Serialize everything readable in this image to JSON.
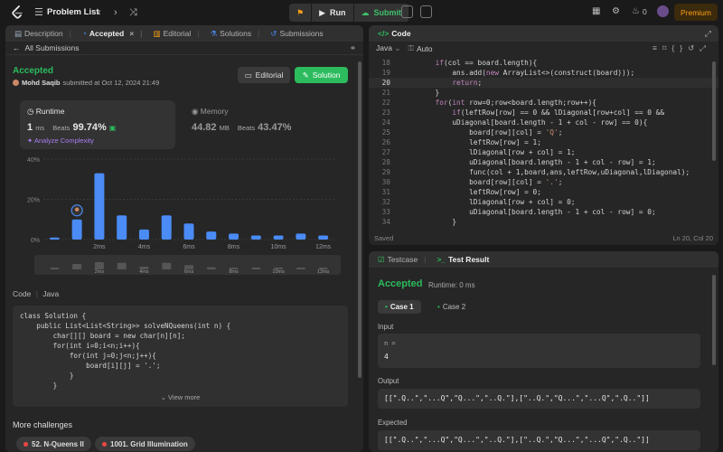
{
  "topbar": {
    "problem_list": "Problem List",
    "run_label": "Run",
    "submit_label": "Submit",
    "streak_count": "0",
    "premium_label": "Premium"
  },
  "left_tabs": [
    {
      "label": "Description",
      "icon": "description-icon"
    },
    {
      "label": "Accepted",
      "icon": "clock-icon"
    },
    {
      "label": "Editorial",
      "icon": "book-icon"
    },
    {
      "label": "Solutions",
      "icon": "flask-icon"
    },
    {
      "label": "Submissions",
      "icon": "history-icon"
    }
  ],
  "submission": {
    "back_label": "All Submissions",
    "status": "Accepted",
    "user": "Mohd Saqib",
    "submitted_text": "submitted at Oct 12, 2024 21:49",
    "editorial_btn": "Editorial",
    "solution_btn": "Solution",
    "runtime_label": "Runtime",
    "runtime_value": "1",
    "runtime_unit": "ms",
    "beats_label": "Beats",
    "runtime_beats": "99.74%",
    "analyze_label": "Analyze Complexity",
    "memory_label": "Memory",
    "memory_value": "44.82",
    "memory_unit": "MB",
    "memory_beats": "43.47%"
  },
  "chart_data": {
    "type": "bar",
    "y_ticks": [
      "40%",
      "20%",
      "0%"
    ],
    "x_ticks": [
      "2ms",
      "4ms",
      "6ms",
      "8ms",
      "10ms",
      "12ms"
    ],
    "values": [
      1,
      10,
      33,
      12,
      5,
      12,
      8,
      4,
      3,
      2,
      2,
      3,
      2
    ],
    "ylim": [
      0,
      40
    ],
    "highlight_index": 1,
    "bar_color": "#4a8bf5"
  },
  "code_section": {
    "header": "Code",
    "language": "Java",
    "lines": [
      "class Solution {",
      "    public List<List<String>> solveNQueens(int n) {",
      "        char[][] board = new char[n][n];",
      "        for(int i=0;i<n;i++){",
      "            for(int j=0;j<n;j++){",
      "                board[i][j] = '.';",
      "            }",
      "        }"
    ],
    "view_more": "View more"
  },
  "more_challenges": {
    "title": "More challenges",
    "items": [
      "52. N-Queens II",
      "1001. Grid Illumination"
    ]
  },
  "editor": {
    "title": "Code",
    "language": "Java",
    "mode": "Auto",
    "status_left": "Saved",
    "status_right": "Ln 20, Col 20",
    "lines": [
      {
        "n": "18",
        "code": "        if(col == board.length){"
      },
      {
        "n": "19",
        "code": "            ans.add(new ArrayList<>(construct(board)));"
      },
      {
        "n": "20",
        "code": "            return;"
      },
      {
        "n": "21",
        "code": "        }"
      },
      {
        "n": "22",
        "code": "        for(int row=0;row<board.length;row++){"
      },
      {
        "n": "23",
        "code": "            if(leftRow[row] == 0 && lDiagonal[row+col] == 0 &&"
      },
      {
        "n": "24",
        "code": "            uDiagonal[board.length - 1 + col - row] == 0){"
      },
      {
        "n": "25",
        "code": "                board[row][col] = 'Q';"
      },
      {
        "n": "26",
        "code": "                leftRow[row] = 1;"
      },
      {
        "n": "27",
        "code": "                lDiagonal[row + col] = 1;"
      },
      {
        "n": "28",
        "code": "                uDiagonal[board.length - 1 + col - row] = 1;"
      },
      {
        "n": "29",
        "code": "                func(col + 1,board,ans,leftRow,uDiagonal,lDiagonal);"
      },
      {
        "n": "30",
        "code": "                board[row][col] = '.';"
      },
      {
        "n": "31",
        "code": "                leftRow[row] = 0;"
      },
      {
        "n": "32",
        "code": "                lDiagonal[row + col] = 0;"
      },
      {
        "n": "33",
        "code": "                uDiagonal[board.length - 1 + col - row] = 0;"
      },
      {
        "n": "34",
        "code": "            }"
      }
    ]
  },
  "result": {
    "tab_testcase": "Testcase",
    "tab_result": "Test Result",
    "status": "Accepted",
    "runtime": "Runtime: 0 ms",
    "cases": [
      "Case 1",
      "Case 2"
    ],
    "input_label": "Input",
    "input_var": "n =",
    "input_value": "4",
    "output_label": "Output",
    "output_value": "[[\".Q..\",\"...Q\",\"Q...\",\"..Q.\"],[\"..Q.\",\"Q...\",\"...Q\",\".Q..\"]]",
    "expected_label": "Expected",
    "expected_value": "[[\".Q..\",\"...Q\",\"Q...\",\"..Q.\"],[\"..Q.\",\"Q...\",\"...Q\",\".Q..\"]]"
  }
}
